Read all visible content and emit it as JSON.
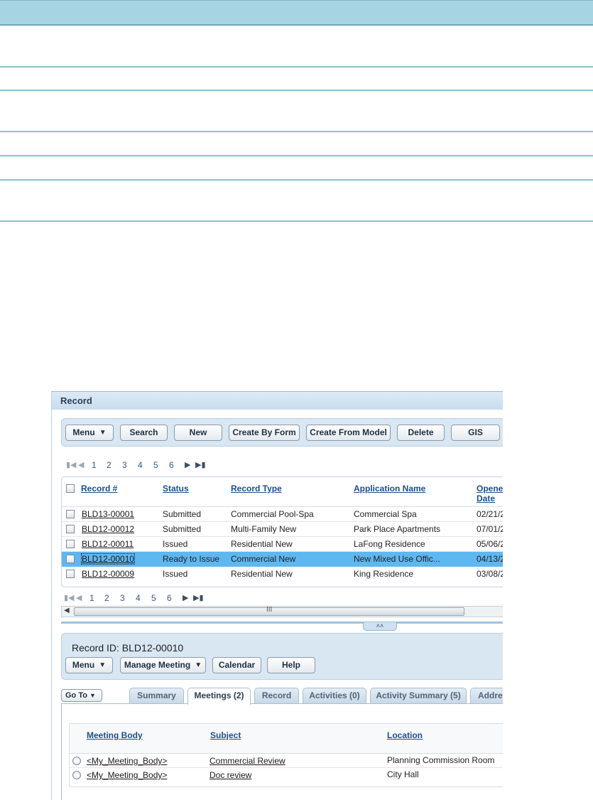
{
  "app": {
    "panel_title": "Record"
  },
  "toolbar": {
    "buttons": [
      "Menu",
      "Search",
      "New",
      "Create By Form",
      "Create From Model",
      "Delete",
      "GIS"
    ]
  },
  "pager": {
    "pages": [
      "1",
      "2",
      "3",
      "4",
      "5",
      "6"
    ]
  },
  "grid": {
    "columns": [
      "Record #",
      "Status",
      "Record Type",
      "Application Name",
      "Opene",
      "Date"
    ],
    "rows": [
      {
        "record": "BLD13-00001",
        "status": "Submitted",
        "type": "Commercial Pool-Spa",
        "name": "Commercial Spa",
        "date": "02/21/2"
      },
      {
        "record": "BLD12-00012",
        "status": "Submitted",
        "type": "Multi-Family New",
        "name": "Park Place Apartments",
        "date": "07/01/2"
      },
      {
        "record": "BLD12-00011",
        "status": "Issued",
        "type": "Residential New",
        "name": "LaFong Residence",
        "date": "05/06/2"
      },
      {
        "record": "BLD12-00010",
        "status": "Ready to Issue",
        "type": "Commercial New",
        "name": "New Mixed Use Offic...",
        "date": "04/13/2"
      },
      {
        "record": "BLD12-00009",
        "status": "Issued",
        "type": "Residential New",
        "name": "King Residence",
        "date": "03/08/2"
      }
    ],
    "selected_row_index": 3,
    "scroll_grip": "III"
  },
  "detail": {
    "title": "Record ID: BLD12-00010",
    "buttons": [
      "Menu",
      "Manage Meeting",
      "Calendar",
      "Help"
    ],
    "goto_label": "Go To",
    "tabs": [
      "Summary",
      "Meetings (2)",
      "Record",
      "Activities (0)",
      "Activity Summary (5)",
      "Addres"
    ],
    "active_tab": "Meetings (2)"
  },
  "meetings": {
    "columns": [
      "Meeting Body",
      "Subject",
      "Location"
    ],
    "rows": [
      {
        "body": "<My_Meeting_Body>",
        "subject": "Commercial Review",
        "location": "Planning Commission Room"
      },
      {
        "body": "<My_Meeting_Body>",
        "subject": "Doc review",
        "location": "City Hall"
      }
    ]
  },
  "colors": {
    "doc_header": "#a8d4e2",
    "selected_row": "#5fb7f0",
    "panel_bg": "#d9e7f3"
  }
}
